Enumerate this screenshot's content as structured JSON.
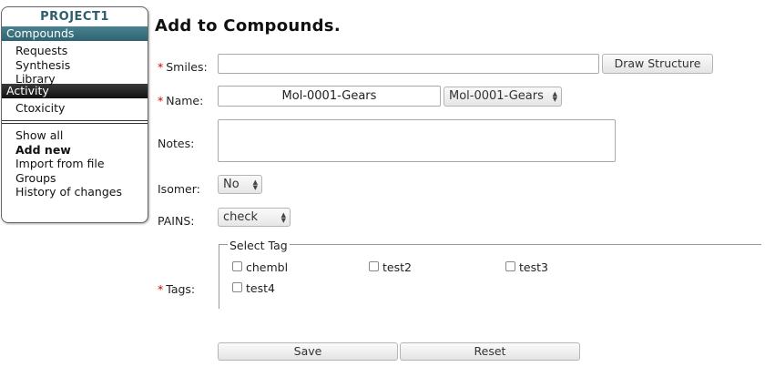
{
  "sidebar": {
    "project_name": "PROJECT1",
    "sections": [
      {
        "title": "Compounds",
        "items": [
          "Requests",
          "Synthesis",
          "Library"
        ]
      },
      {
        "title": "Activity",
        "items": [
          "Ctoxicity"
        ]
      }
    ],
    "actions": [
      "Show all",
      "Add new",
      "Import from file",
      "Groups",
      "History of changes"
    ],
    "active_action": "Add new"
  },
  "page": {
    "title": "Add to Compounds."
  },
  "form": {
    "smiles": {
      "label": "Smiles:",
      "required": "*",
      "value": "",
      "draw_button": "Draw Structure"
    },
    "name": {
      "label": "Name:",
      "required": "*",
      "value": "Mol-0001-Gears",
      "select_value": "Mol-0001-Gears"
    },
    "notes": {
      "label": "Notes:",
      "value": ""
    },
    "isomer": {
      "label": "Isomer:",
      "value": "No"
    },
    "pains": {
      "label": "PAINS:",
      "value": "check"
    },
    "tags": {
      "label": "Tags:",
      "required": "*",
      "legend": "Select Tag",
      "options": [
        "chembl",
        "test2",
        "test3",
        "test4"
      ]
    },
    "save_label": "Save",
    "reset_label": "Reset"
  },
  "colors": {
    "required_mark": "#cc0000",
    "compounds_header": "#3d7482",
    "activity_header": "#222222",
    "project_title": "#2e5e6e"
  }
}
